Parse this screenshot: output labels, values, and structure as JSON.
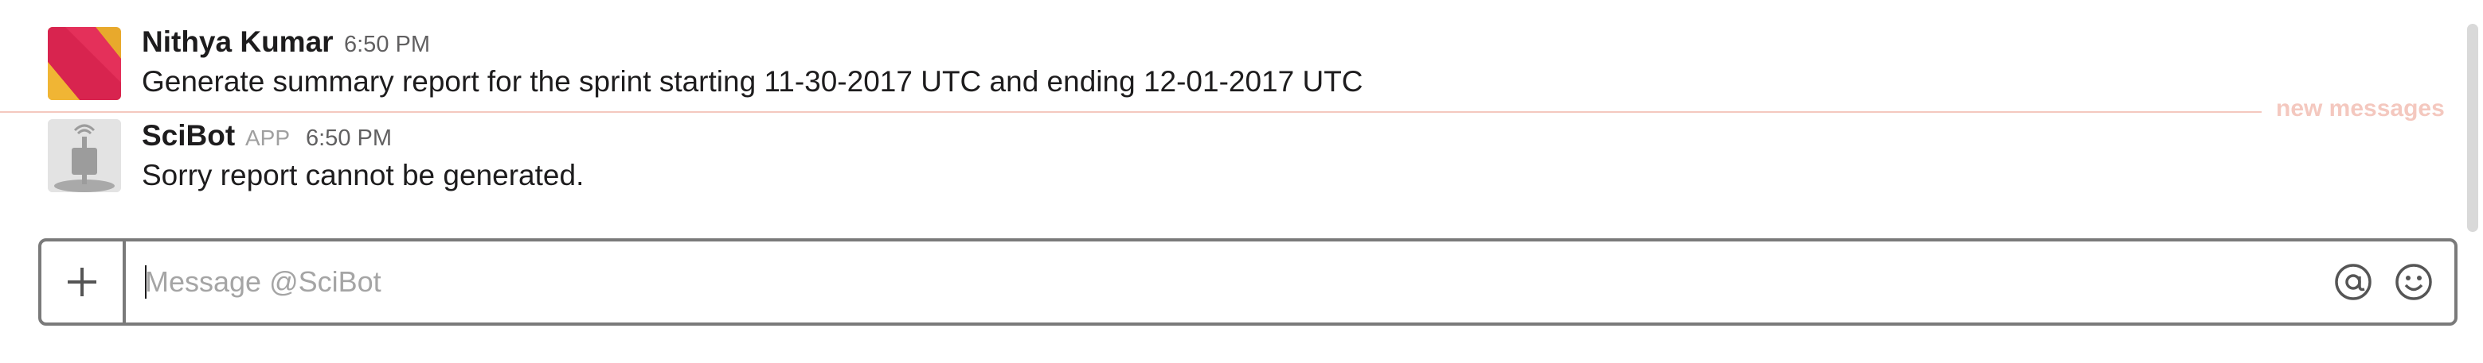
{
  "messages": [
    {
      "sender": "Nithya Kumar",
      "time": "6:50 PM",
      "text": "Generate summary report for the sprint starting 11-30-2017 UTC and ending 12-01-2017 UTC"
    },
    {
      "sender": "SciBot",
      "tag": "APP",
      "time": "6:50 PM",
      "text": "Sorry report cannot be generated."
    }
  ],
  "divider": {
    "label": "new messages",
    "color": "#f4c8bf"
  },
  "composer": {
    "placeholder": "Message @SciBot",
    "value": ""
  },
  "icons": {
    "add": "plus-icon",
    "mention": "at-sign-icon",
    "emoji": "smiley-icon"
  }
}
